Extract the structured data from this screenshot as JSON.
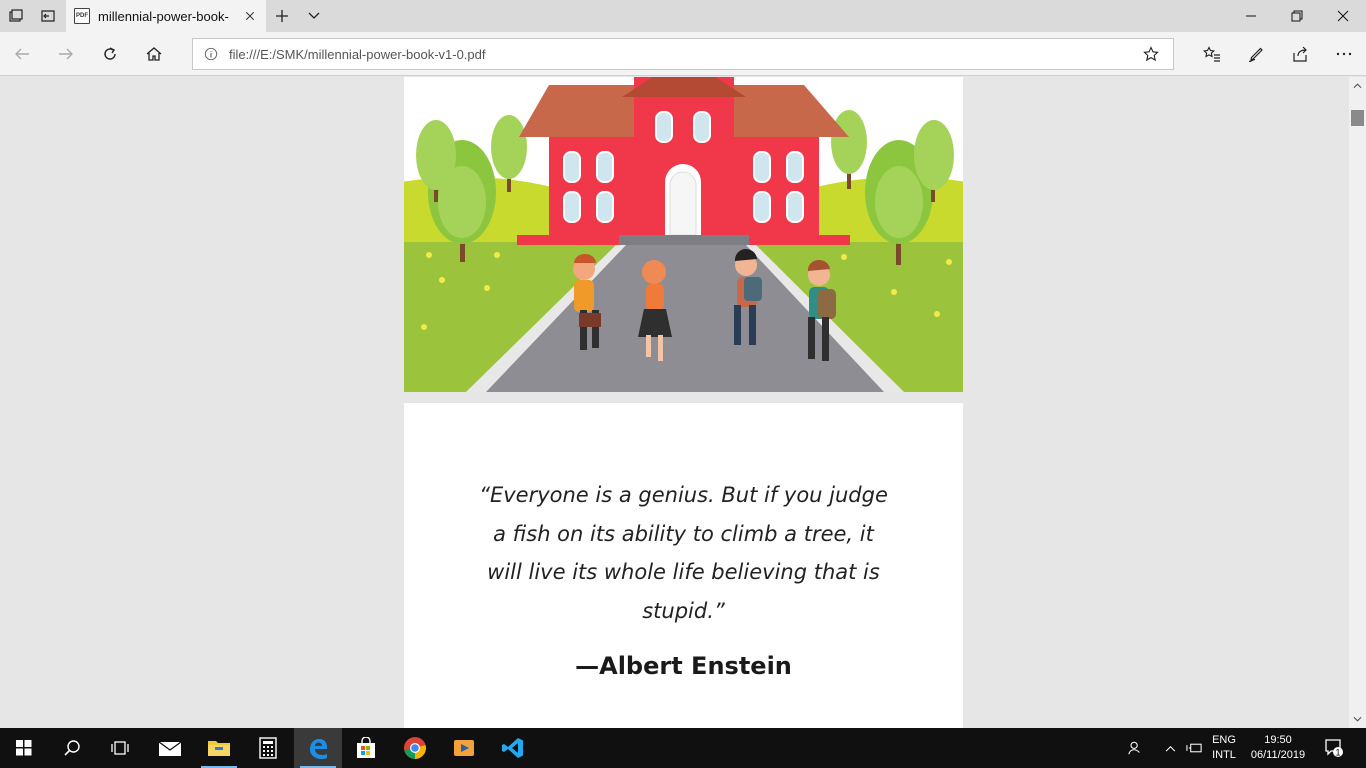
{
  "browser": {
    "tab": {
      "title": "millennial-power-book-",
      "icon": "pdf-icon"
    },
    "address": {
      "url": "file:///E:/SMK/millennial-power-book-v1-0.pdf"
    }
  },
  "document": {
    "quote": "“Everyone is a genius. But if you judge a fish on its ability to climb a tree, it will live its whole life believing that is stupid.”",
    "author": "—Albert Enstein"
  },
  "taskbar": {
    "apps": [
      "start-icon",
      "search-icon",
      "task-view-icon",
      "mail-icon",
      "file-explorer-icon",
      "calculator-icon",
      "edge-icon",
      "store-icon",
      "chrome-icon",
      "media-player-icon",
      "vscode-icon"
    ],
    "language_line1": "ENG",
    "language_line2": "INTL",
    "time": "19:50",
    "date": "06/11/2019",
    "notification_count": "1"
  },
  "colors": {
    "accent": "#0078d7",
    "school": "#f0384a",
    "grass": "#9bc43c",
    "taskbar": "#101010"
  }
}
